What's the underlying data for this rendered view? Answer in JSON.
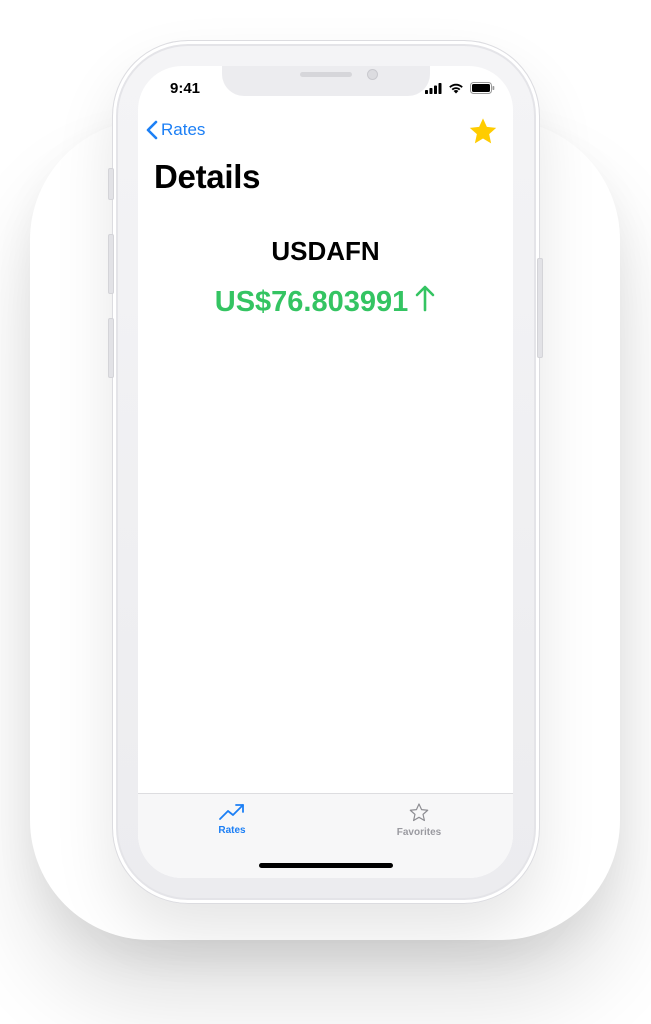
{
  "status_bar": {
    "time": "9:41",
    "icons": [
      "signal-icon",
      "wifi-icon",
      "battery-icon"
    ]
  },
  "nav": {
    "back_label": "Rates",
    "favorite_icon": "star-filled-icon",
    "favorite_color": "#ffcc00"
  },
  "page": {
    "title": "Details"
  },
  "detail": {
    "pair": "USDAFN",
    "rate": "US$76.803991",
    "trend": "up",
    "trend_glyph": "↑",
    "trend_color": "#34c462"
  },
  "tab_bar": {
    "tabs": [
      {
        "label": "Rates",
        "icon": "trending-up-icon",
        "active": true
      },
      {
        "label": "Favorites",
        "icon": "star-outline-icon",
        "active": false
      }
    ],
    "accent": "#1c7ff5"
  }
}
